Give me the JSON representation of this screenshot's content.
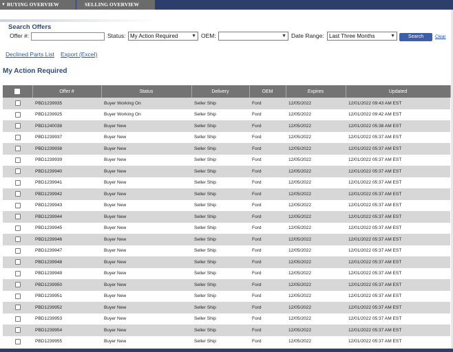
{
  "nav": {
    "tabs": [
      {
        "label": "BUYING OVERVIEW",
        "caret": "▼"
      },
      {
        "label": "SELLING OVERVIEW"
      }
    ]
  },
  "search": {
    "title": "Search Offers",
    "offer_label": "Offer #:",
    "offer_value": "",
    "status_label": "Status:",
    "status_value": "My Action Required",
    "oem_label": "OEM:",
    "oem_value": "",
    "date_label": "Date Range:",
    "date_value": "Last Three Months",
    "search_button": "Search",
    "clear_link": "Clear"
  },
  "links": {
    "declined": "Declined Parts List",
    "export": "Export (Excel)"
  },
  "section_title": "My Action Required",
  "table": {
    "headers": [
      "",
      "Offer #",
      "Status",
      "Delivery",
      "OEM",
      "Expires",
      "Updated"
    ],
    "rows": [
      [
        "PBD1239935",
        "Buyer Working On",
        "Seller Ship",
        "Ford",
        "12/05/2022",
        "12/01/2022 09:43 AM EST"
      ],
      [
        "PBD1239925",
        "Buyer Working On",
        "Seller Ship",
        "Ford",
        "12/05/2022",
        "12/01/2022 09:42 AM EST"
      ],
      [
        "PBD1240038",
        "Buyer New",
        "Seller Ship",
        "Ford",
        "12/05/2022",
        "12/01/2022 05:38 AM EST"
      ],
      [
        "PBD1239937",
        "Buyer New",
        "Seller Ship",
        "Ford",
        "12/05/2022",
        "12/01/2022 05:37 AM EST"
      ],
      [
        "PBD1239938",
        "Buyer New",
        "Seller Ship",
        "Ford",
        "12/05/2022",
        "12/01/2022 05:37 AM EST"
      ],
      [
        "PBD1239939",
        "Buyer New",
        "Seller Ship",
        "Ford",
        "12/05/2022",
        "12/01/2022 05:37 AM EST"
      ],
      [
        "PBD1239940",
        "Buyer New",
        "Seller Ship",
        "Ford",
        "12/05/2022",
        "12/01/2022 05:37 AM EST"
      ],
      [
        "PBD1239941",
        "Buyer New",
        "Seller Ship",
        "Ford",
        "12/05/2022",
        "12/01/2022 05:37 AM EST"
      ],
      [
        "PBD1239942",
        "Buyer New",
        "Seller Ship",
        "Ford",
        "12/05/2022",
        "12/01/2022 05:37 AM EST"
      ],
      [
        "PBD1239943",
        "Buyer New",
        "Seller Ship",
        "Ford",
        "12/05/2022",
        "12/01/2022 05:37 AM EST"
      ],
      [
        "PBD1239944",
        "Buyer New",
        "Seller Ship",
        "Ford",
        "12/05/2022",
        "12/01/2022 05:37 AM EST"
      ],
      [
        "PBD1239945",
        "Buyer New",
        "Seller Ship",
        "Ford",
        "12/05/2022",
        "12/01/2022 05:37 AM EST"
      ],
      [
        "PBD1239946",
        "Buyer New",
        "Seller Ship",
        "Ford",
        "12/05/2022",
        "12/01/2022 05:37 AM EST"
      ],
      [
        "PBD1239947",
        "Buyer New",
        "Seller Ship",
        "Ford",
        "12/05/2022",
        "12/01/2022 05:37 AM EST"
      ],
      [
        "PBD1239948",
        "Buyer New",
        "Seller Ship",
        "Ford",
        "12/05/2022",
        "12/01/2022 05:37 AM EST"
      ],
      [
        "PBD1239949",
        "Buyer New",
        "Seller Ship",
        "Ford",
        "12/05/2022",
        "12/01/2022 05:37 AM EST"
      ],
      [
        "PBD1239950",
        "Buyer New",
        "Seller Ship",
        "Ford",
        "12/05/2022",
        "12/01/2022 05:37 AM EST"
      ],
      [
        "PBD1239951",
        "Buyer New",
        "Seller Ship",
        "Ford",
        "12/05/2022",
        "12/01/2022 05:37 AM EST"
      ],
      [
        "PBD1239952",
        "Buyer New",
        "Seller Ship",
        "Ford",
        "12/05/2022",
        "12/01/2022 05:37 AM EST"
      ],
      [
        "PBD1239953",
        "Buyer New",
        "Seller Ship",
        "Ford",
        "12/05/2022",
        "12/01/2022 05:37 AM EST"
      ],
      [
        "PBD1239954",
        "Buyer New",
        "Seller Ship",
        "Ford",
        "12/05/2022",
        "12/01/2022 05:37 AM EST"
      ],
      [
        "PBD1239955",
        "Buyer New",
        "Seller Ship",
        "Ford",
        "12/05/2022",
        "12/01/2022 05:37 AM EST"
      ]
    ]
  },
  "icons": {
    "caret": "chevron-down-icon",
    "select_arrow": "dropdown-arrow-icon"
  },
  "colors": {
    "nav_bar": "#2c3f6a",
    "tab_bg": "#6b6b6b",
    "title_blue": "#2a4a7c",
    "button_blue": "#3d5fa8",
    "header_gray": "#747474",
    "row_alt": "#d7d7d7"
  }
}
